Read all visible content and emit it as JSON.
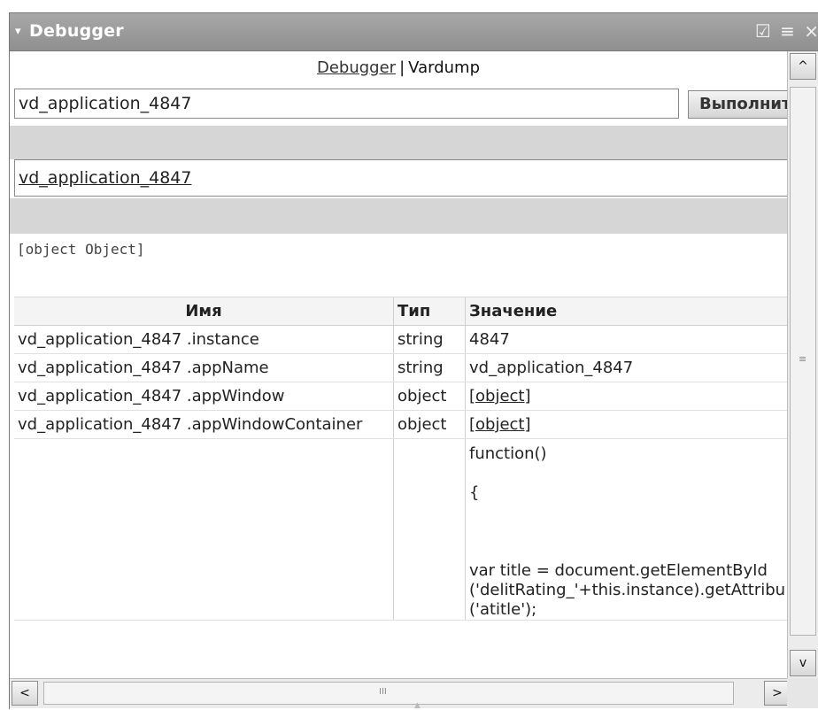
{
  "window": {
    "title": "Debugger",
    "collapse_glyph": "▾",
    "icons": [
      {
        "name": "checkbox-icon",
        "glyph": "☑"
      },
      {
        "name": "menu-icon",
        "glyph": "≡"
      },
      {
        "name": "close-icon",
        "glyph": "×"
      }
    ]
  },
  "tabs": {
    "debugger": "Debugger",
    "separator": "|",
    "vardump": "Vardump"
  },
  "command": {
    "value": "vd_application_4847",
    "run_label": "Выполнить"
  },
  "result": {
    "link": "vd_application_4847",
    "dump": "[object Object]"
  },
  "table": {
    "headers": {
      "name": "Имя",
      "type": "Тип",
      "value": "Значение"
    },
    "rows": [
      {
        "name": "vd_application_4847 .instance",
        "type": "string",
        "value": "4847"
      },
      {
        "name": "vd_application_4847 .appName",
        "type": "string",
        "value": "vd_application_4847"
      },
      {
        "name": "vd_application_4847 .appWindow",
        "type": "object",
        "value": "[object]"
      },
      {
        "name": "vd_application_4847 .appWindowContainer",
        "type": "object",
        "value": "[object]"
      }
    ],
    "function_row": {
      "name": "",
      "type": "",
      "lines": [
        "function()",
        "{",
        "var title = document.getElementById",
        "('delitRating_'+this.instance).getAttribu",
        "('atitle');"
      ]
    }
  },
  "scrollbars": {
    "up_glyph": "^",
    "down_glyph": "v",
    "left_glyph": "<",
    "right_glyph": ">",
    "v_grip": "≡",
    "h_grip": "III"
  }
}
